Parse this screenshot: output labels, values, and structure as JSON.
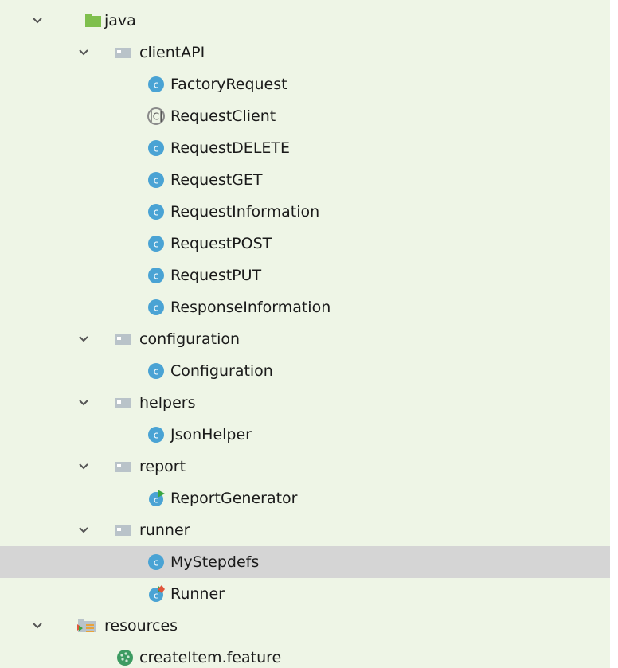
{
  "colors": {
    "panel_background": "#eef5e6",
    "selection": "#d5d5d5",
    "class_icon": "#4aa3d4",
    "folder": "#b9c3c9",
    "source_folder": "#7fbf4d",
    "cucumber": "#3d9b62"
  },
  "tree": {
    "items": [
      {
        "label": "java",
        "icon": "source-folder-icon",
        "expanded": true
      },
      {
        "label": "clientAPI",
        "icon": "package-folder-icon",
        "expanded": true
      },
      {
        "label": "FactoryRequest",
        "icon": "java-class-icon"
      },
      {
        "label": "RequestClient",
        "icon": "java-interface-icon"
      },
      {
        "label": "RequestDELETE",
        "icon": "java-class-icon"
      },
      {
        "label": "RequestGET",
        "icon": "java-class-icon"
      },
      {
        "label": "RequestInformation",
        "icon": "java-class-icon"
      },
      {
        "label": "RequestPOST",
        "icon": "java-class-icon"
      },
      {
        "label": "RequestPUT",
        "icon": "java-class-icon"
      },
      {
        "label": "ResponseInformation",
        "icon": "java-class-icon"
      },
      {
        "label": "configuration",
        "icon": "package-folder-icon",
        "expanded": true
      },
      {
        "label": "Configuration",
        "icon": "java-class-icon"
      },
      {
        "label": "helpers",
        "icon": "package-folder-icon",
        "expanded": true
      },
      {
        "label": "JsonHelper",
        "icon": "java-class-icon"
      },
      {
        "label": "report",
        "icon": "package-folder-icon",
        "expanded": true
      },
      {
        "label": "ReportGenerator",
        "icon": "java-main-class-icon"
      },
      {
        "label": "runner",
        "icon": "package-folder-icon",
        "expanded": true
      },
      {
        "label": "MyStepdefs",
        "icon": "java-class-icon",
        "selected": true
      },
      {
        "label": "Runner",
        "icon": "java-test-class-icon"
      },
      {
        "label": "resources",
        "icon": "resources-folder-icon",
        "expanded": true
      },
      {
        "label": "createItem.feature",
        "icon": "cucumber-feature-icon"
      }
    ]
  }
}
